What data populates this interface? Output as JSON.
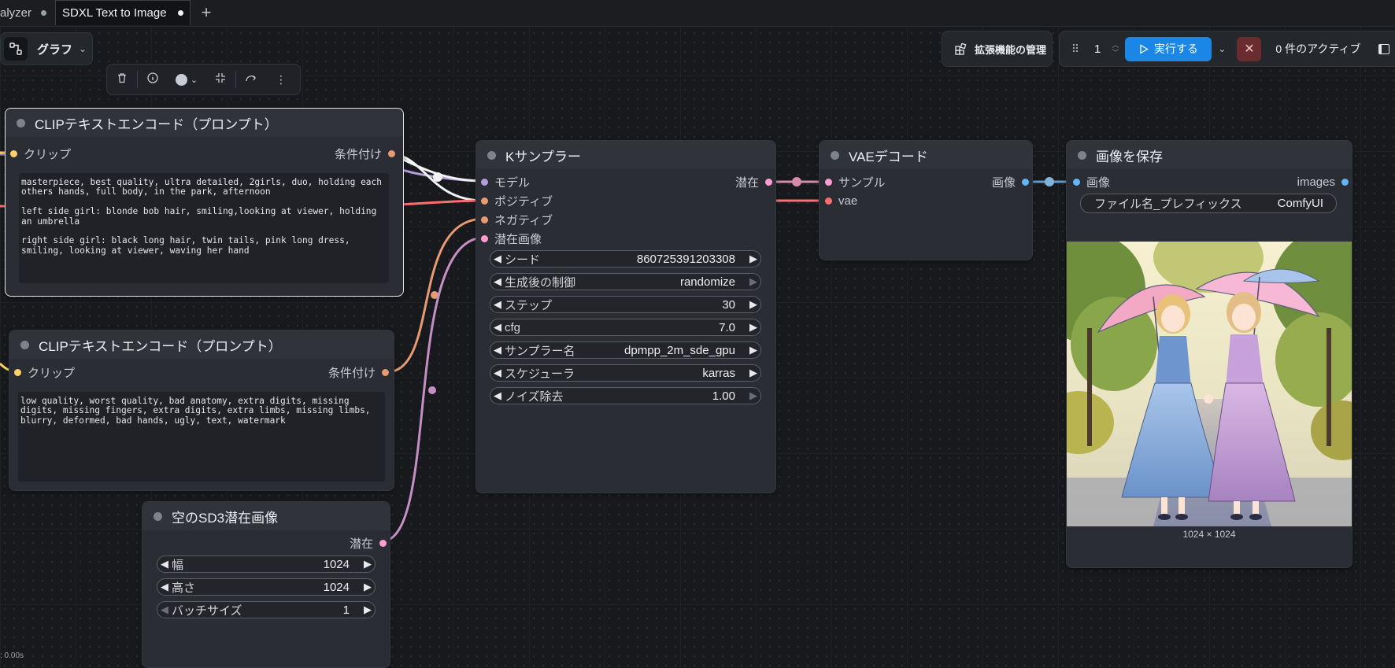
{
  "tabs": [
    {
      "label": "alyzer"
    },
    {
      "label": "SDXL Text to Image"
    }
  ],
  "graph_menu": {
    "label": "グラフ"
  },
  "toolbar_right": {
    "extensions_label": "拡張機能の管理",
    "queue_count": "1",
    "run_label": "実行する",
    "active_label": "0 件のアクティブ"
  },
  "status_footer": ": 0.00s",
  "nodes": {
    "clip_pos": {
      "title": "CLIPテキストエンコード（プロンプト）",
      "input": "クリップ",
      "output": "条件付け",
      "text": "masterpiece, best quality, ultra detailed, 2girls, duo, holding each others hands, full body, in the park, afternoon\n\nleft side girl: blonde bob hair, smiling,looking at viewer, holding an umbrella\n\nright side girl: black long hair, twin tails, pink long dress, smiling, looking at viewer, waving her hand"
    },
    "clip_neg": {
      "title": "CLIPテキストエンコード（プロンプト）",
      "input": "クリップ",
      "output": "条件付け",
      "text": "low quality, worst quality, bad anatomy, extra digits, missing digits, missing fingers, extra digits, extra limbs, missing limbs, blurry, deformed, bad hands, ugly, text, watermark"
    },
    "latent": {
      "title": "空のSD3潜在画像",
      "output": "潜在",
      "widgets": [
        {
          "label": "幅",
          "value": "1024"
        },
        {
          "label": "高さ",
          "value": "1024"
        },
        {
          "label": "バッチサイズ",
          "value": "1"
        }
      ]
    },
    "ksampler": {
      "title": "Kサンプラー",
      "inputs": [
        "モデル",
        "ポジティブ",
        "ネガティブ",
        "潜在画像"
      ],
      "output": "潜在",
      "widgets": [
        {
          "label": "シード",
          "value": "860725391203308"
        },
        {
          "label": "生成後の制御",
          "value": "randomize"
        },
        {
          "label": "ステップ",
          "value": "30"
        },
        {
          "label": "cfg",
          "value": "7.0"
        },
        {
          "label": "サンプラー名",
          "value": "dpmpp_2m_sde_gpu"
        },
        {
          "label": "スケジューラ",
          "value": "karras"
        },
        {
          "label": "ノイズ除去",
          "value": "1.00"
        }
      ]
    },
    "vae": {
      "title": "VAEデコード",
      "inputs": [
        "サンプル",
        "vae"
      ],
      "output": "画像"
    },
    "save": {
      "title": "画像を保存",
      "input": "画像",
      "output": "images",
      "prefix_label": "ファイル名_プレフィックス",
      "prefix_value": "ComfyUI",
      "image_size": "1024 × 1024"
    }
  },
  "colors": {
    "clip": "#ffd166",
    "conditioning": "#e89a73",
    "model": "#b39ddb",
    "latent": "#ff9cd0",
    "vae": "#ff6e6e",
    "image": "#64b5f6",
    "run_button": "#1a86e6"
  }
}
